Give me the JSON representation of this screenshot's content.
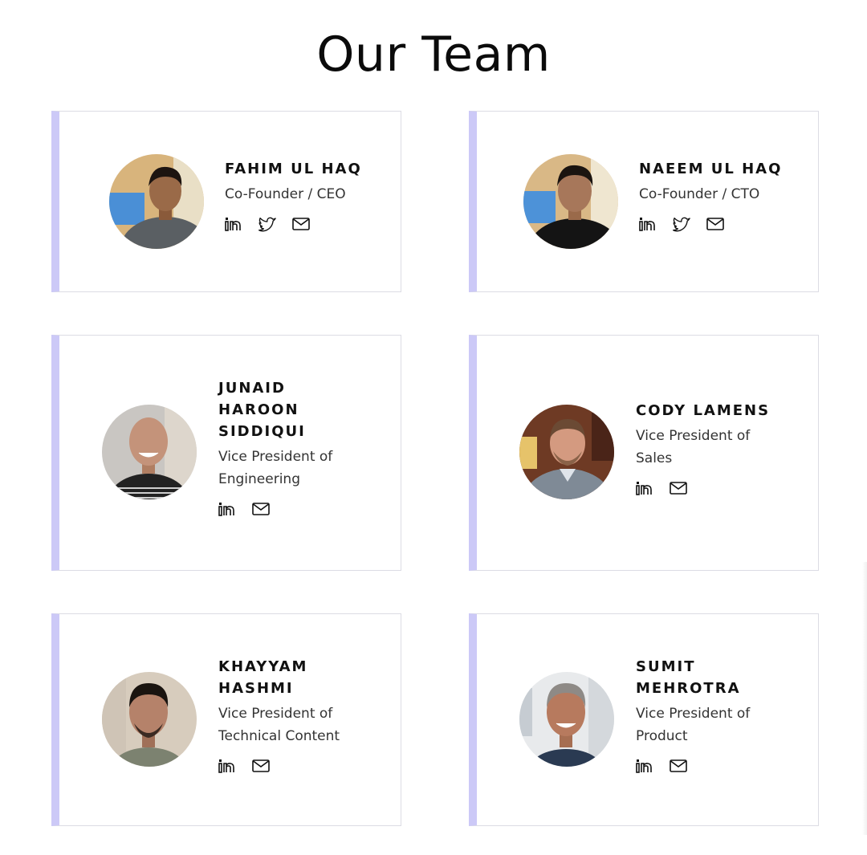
{
  "page": {
    "title": "Our Team"
  },
  "colors": {
    "accent_bar": "#ccc9f7",
    "card_border": "#dcdce4"
  },
  "members": [
    {
      "name_lines": [
        "FAHIM UL HAQ"
      ],
      "role_lines": [
        "Co-Founder / CEO"
      ],
      "socials": [
        "linkedin-icon",
        "twitter-icon",
        "mail-icon"
      ]
    },
    {
      "name_lines": [
        "NAEEM UL HAQ"
      ],
      "role_lines": [
        "Co-Founder / CTO"
      ],
      "socials": [
        "linkedin-icon",
        "twitter-icon",
        "mail-icon"
      ]
    },
    {
      "name_lines": [
        "JUNAID",
        "HAROON",
        "SIDDIQUI"
      ],
      "role_lines": [
        "Vice President of",
        "Engineering"
      ],
      "socials": [
        "linkedin-icon",
        "mail-icon"
      ]
    },
    {
      "name_lines": [
        "CODY LAMENS"
      ],
      "role_lines": [
        "Vice President of",
        "Sales"
      ],
      "socials": [
        "linkedin-icon",
        "mail-icon"
      ]
    },
    {
      "name_lines": [
        "KHAYYAM",
        "HASHMI"
      ],
      "role_lines": [
        "Vice President of",
        "Technical Content"
      ],
      "socials": [
        "linkedin-icon",
        "mail-icon"
      ]
    },
    {
      "name_lines": [
        "SUMIT",
        "MEHROTRA"
      ],
      "role_lines": [
        "Vice President of",
        "Product"
      ],
      "socials": [
        "linkedin-icon",
        "mail-icon"
      ]
    }
  ]
}
